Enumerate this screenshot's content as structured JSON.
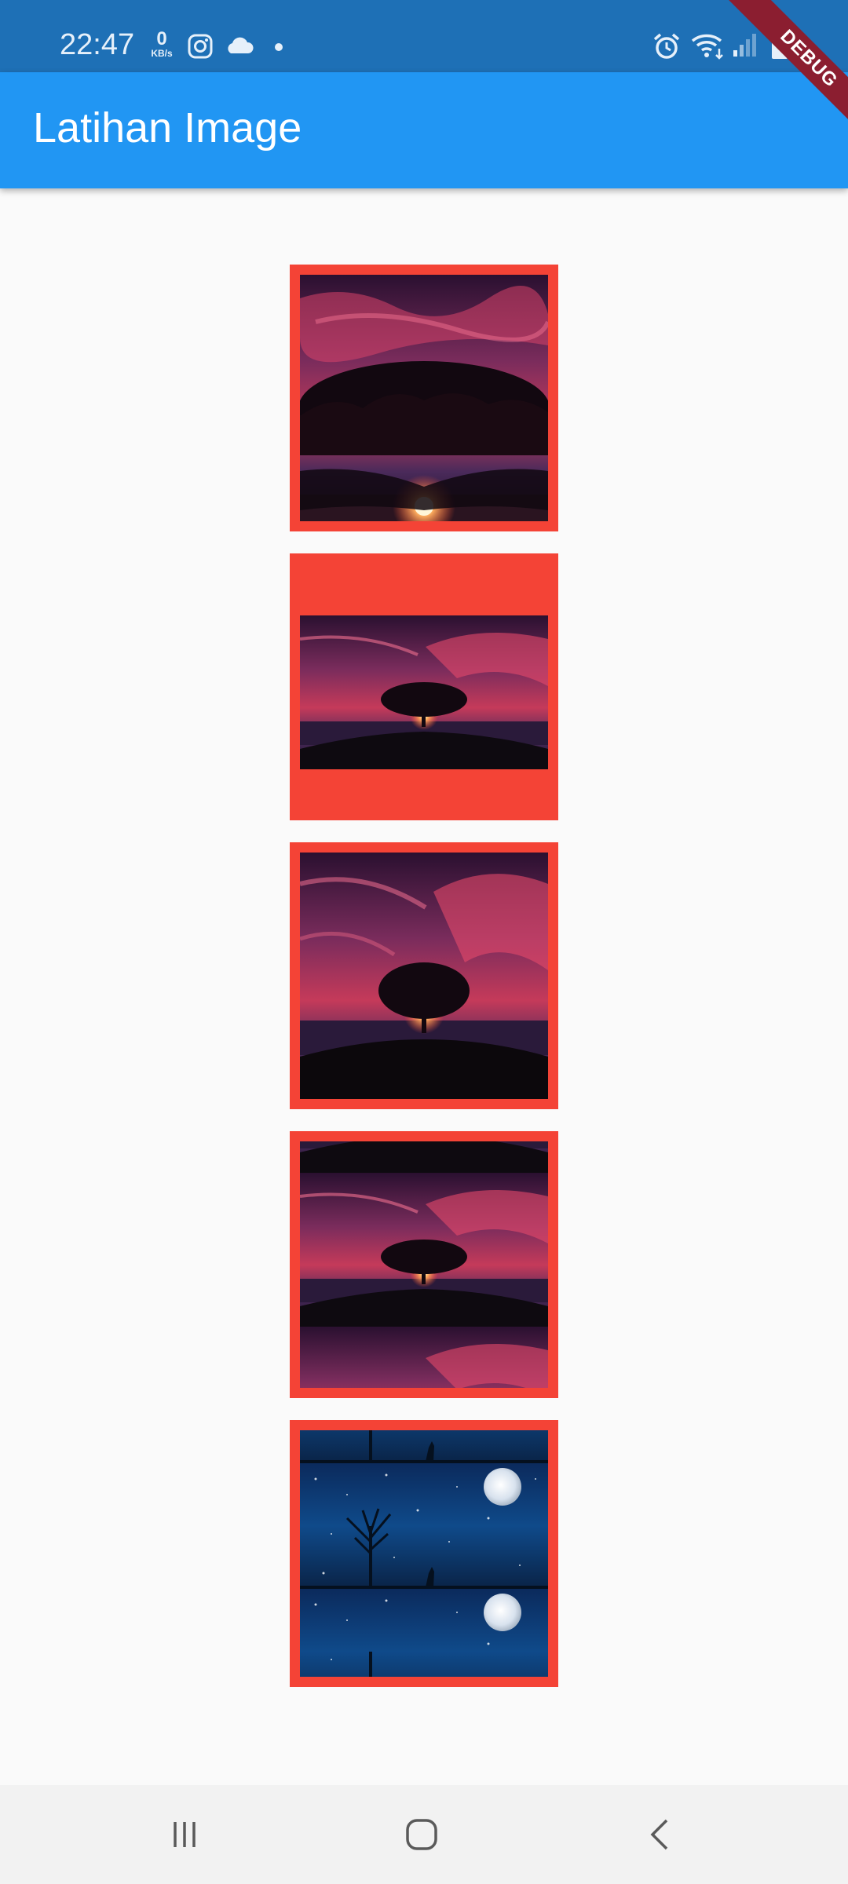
{
  "status_bar": {
    "time": "22:47",
    "net_speed_value": "0",
    "net_speed_unit": "KB/s",
    "icons": [
      "instagram-icon",
      "cloud-icon",
      "dot-icon",
      "alarm-icon",
      "wifi-icon",
      "signal-icon",
      "battery-icon"
    ]
  },
  "debug_banner": "DEBUG",
  "app_bar": {
    "title": "Latihan Image",
    "color": "#2196f3"
  },
  "image_boxes": [
    {
      "name": "image-box-1",
      "fit": "fill"
    },
    {
      "name": "image-box-2",
      "fit": "contain"
    },
    {
      "name": "image-box-3",
      "fit": "cover"
    },
    {
      "name": "image-box-4",
      "fit": "repeat"
    },
    {
      "name": "image-box-5",
      "fit": "repeat"
    }
  ],
  "box_color": "#f44336",
  "nav_bar": {
    "buttons": [
      "recent-apps-icon",
      "home-icon",
      "back-icon"
    ]
  }
}
